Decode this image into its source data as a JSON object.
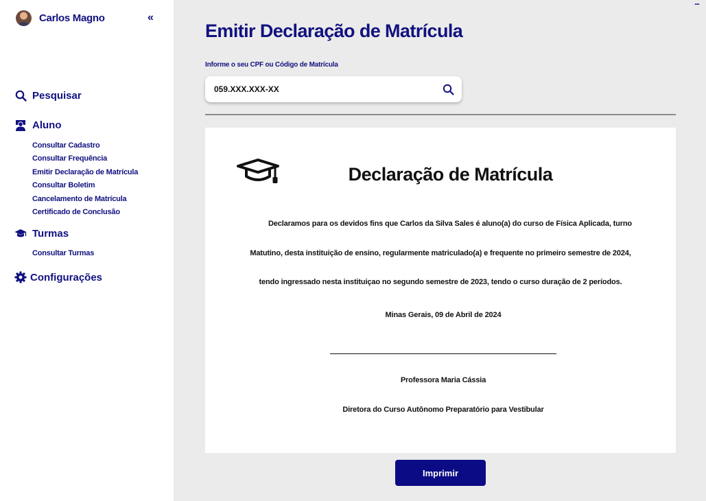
{
  "sidebar": {
    "user_name": "Carlos Magno",
    "collapse_icon": "«",
    "nav": {
      "pesquisar": "Pesquisar",
      "aluno": "Aluno",
      "turmas": "Turmas",
      "configuracoes": "Configurações"
    },
    "aluno_items": [
      "Consultar Cadastro",
      "Consultar Frequência",
      "Emitir Declaração de Matrícula",
      "Consultar Boletim",
      "Cancelamento de Matrícula",
      "Certificado de Conclusão"
    ],
    "turmas_items": [
      "Consultar Turmas"
    ]
  },
  "main": {
    "title": "Emitir Declaração de Matrícula",
    "field_label": "Informe o seu CPF ou Código de Matrícula",
    "search_value": "059.XXX.XXX-XX",
    "more_icon": "...",
    "print_label": "Imprimir"
  },
  "document": {
    "title": "Declaração de Matrícula",
    "line1": "Declaramos para os devidos fins que Carlos da Silva Sales é aluno(a) do curso de Física Aplicada, turno",
    "line2": "Matutino, desta instituição de ensino, regularmente matriculado(a) e frequente no primeiro semestre de 2024,",
    "line3": "tendo ingressado nesta instituiçao no segundo semestre de 2023, tendo o curso duração de 2 períodos.",
    "place_date": "Minas Gerais, 09 de Abril de 2024",
    "signer_name": "Professora Maria Cássia",
    "signer_role": "Diretora do Curso Autônomo Preparatório para Vestibular"
  },
  "colors": {
    "primary": "#111180",
    "button": "#0b0b85",
    "background": "#ebebeb"
  },
  "icons": [
    "search-icon",
    "teacher-icon",
    "graduation-cap-icon",
    "gear-icon",
    "avatar"
  ]
}
